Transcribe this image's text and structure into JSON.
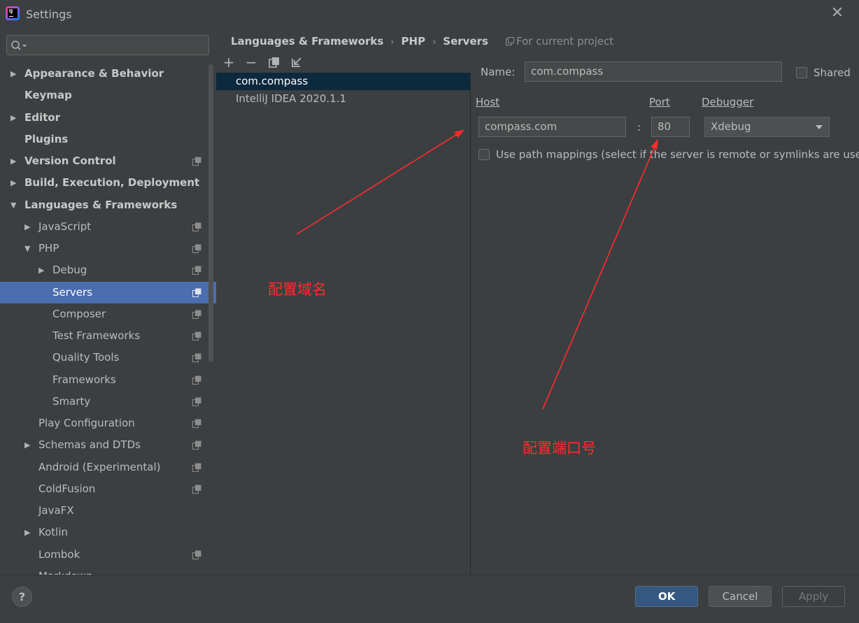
{
  "window": {
    "title": "Settings",
    "close_icon": "close-icon"
  },
  "search": {
    "placeholder": "",
    "icon": "search-icon"
  },
  "sidebar": {
    "items": [
      {
        "label": "Appearance & Behavior",
        "arrow": "▶",
        "bold": true
      },
      {
        "label": "Keymap",
        "arrow": "",
        "bold": true
      },
      {
        "label": "Editor",
        "arrow": "▶",
        "bold": true
      },
      {
        "label": "Plugins",
        "arrow": "",
        "bold": true
      },
      {
        "label": "Version Control",
        "arrow": "▶",
        "bold": true,
        "project": true
      },
      {
        "label": "Build, Execution, Deployment",
        "arrow": "▶",
        "bold": true
      },
      {
        "label": "Languages & Frameworks",
        "arrow": "▼",
        "bold": true
      },
      {
        "label": "JavaScript",
        "arrow": "▶",
        "project": true
      },
      {
        "label": "PHP",
        "arrow": "▼",
        "project": true
      },
      {
        "label": "Debug",
        "arrow": "▶",
        "project": true
      },
      {
        "label": "Servers",
        "arrow": "",
        "project": true,
        "selected": true
      },
      {
        "label": "Composer",
        "arrow": "",
        "project": true
      },
      {
        "label": "Test Frameworks",
        "arrow": "",
        "project": true
      },
      {
        "label": "Quality Tools",
        "arrow": "",
        "project": true
      },
      {
        "label": "Frameworks",
        "arrow": "",
        "project": true
      },
      {
        "label": "Smarty",
        "arrow": "",
        "project": true
      },
      {
        "label": "Play Configuration",
        "arrow": "",
        "project": true
      },
      {
        "label": "Schemas and DTDs",
        "arrow": "▶",
        "project": true
      },
      {
        "label": "Android (Experimental)",
        "arrow": "",
        "project": true
      },
      {
        "label": "ColdFusion",
        "arrow": "",
        "project": true
      },
      {
        "label": "JavaFX",
        "arrow": ""
      },
      {
        "label": "Kotlin",
        "arrow": "▶"
      },
      {
        "label": "Lombok",
        "arrow": "",
        "project": true
      },
      {
        "label": "Markdown",
        "arrow": ""
      }
    ]
  },
  "breadcrumb": {
    "part1": "Languages & Frameworks",
    "part2": "PHP",
    "part3": "Servers",
    "sep": "›"
  },
  "scope_note": "For current project",
  "toolbar": {
    "add": "+",
    "remove": "−",
    "copy_icon": "copy-icon",
    "import_icon": "import-icon"
  },
  "servers": [
    "com.compass",
    "IntelliJ IDEA 2020.1.1"
  ],
  "form": {
    "name_label": "Name:",
    "name_value": "com.compass",
    "shared_label": "Shared",
    "host_label": "Host",
    "host_value": "compass.com",
    "port_label": "Port",
    "port_value": "80",
    "colon": ":",
    "debugger_label": "Debugger",
    "debugger_value": "Xdebug",
    "path_mappings_label": "Use path mappings (select if the server is remote or symlinks are used)"
  },
  "footer": {
    "help": "?",
    "ok": "OK",
    "cancel": "Cancel",
    "apply": "Apply"
  },
  "annotations": {
    "domain_note": "配置域名",
    "port_note": "配置端口号",
    "color": "#ff2b2b"
  }
}
